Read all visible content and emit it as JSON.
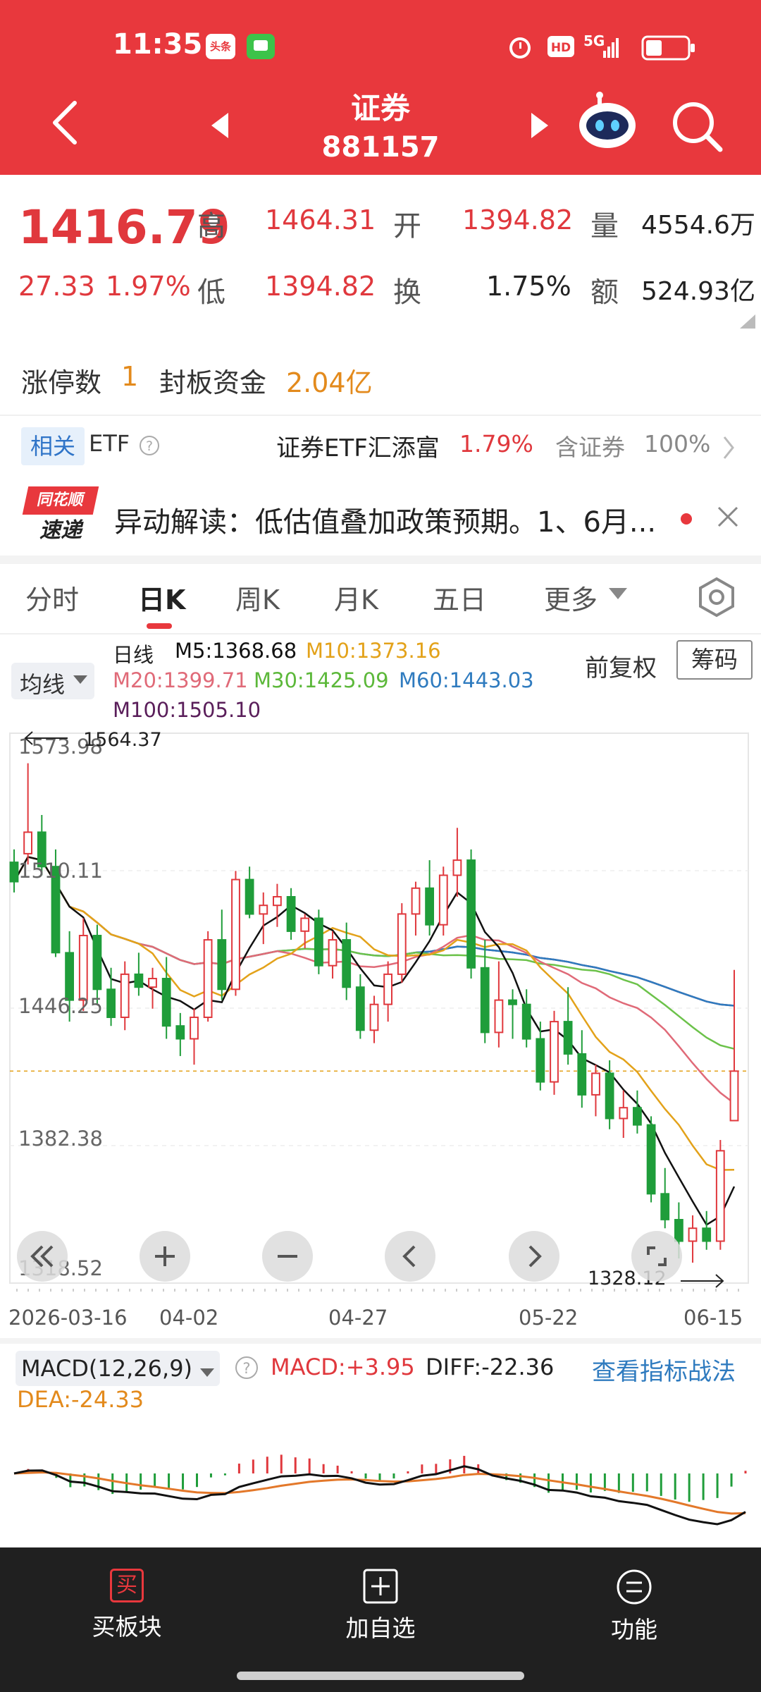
{
  "status_bar": {
    "time": "11:35",
    "app_badge": "头条",
    "network": "5G"
  },
  "header": {
    "title": "证券",
    "code": "881157"
  },
  "quote": {
    "price": "1416.79",
    "change": "27.33",
    "change_pct": "1.97%",
    "high_label": "高",
    "high": "1464.31",
    "low_label": "低",
    "low": "1394.82",
    "open_label": "开",
    "open": "1394.82",
    "turnover_label": "换",
    "turnover": "1.75%",
    "volume_label": "量",
    "volume": "4554.6万",
    "amount_label": "额",
    "amount": "524.93亿"
  },
  "limit_info": {
    "limit_up_label": "涨停数",
    "limit_up_count": "1",
    "seal_label": "封板资金",
    "seal_value": "2.04亿"
  },
  "etf": {
    "tag": "相关",
    "label": "ETF",
    "name": "证券ETF汇添富",
    "pct": "1.79%",
    "contain_label": "含证券",
    "contain_pct": "100%"
  },
  "news": {
    "logo_top": "同花顺",
    "logo_bottom": "速递",
    "text": "异动解读：低估值叠加政策预期。1、6月..."
  },
  "tabs": [
    "分时",
    "日K",
    "周K",
    "月K",
    "五日",
    "更多"
  ],
  "active_tab": "日K",
  "ma_panel": {
    "selector": "均线",
    "line_label": "日线",
    "m5": "M5:1368.68",
    "m10": "M10:1373.16",
    "m20": "M20:1399.71",
    "m30": "M30:1425.09",
    "m60": "M60:1443.03",
    "m100": "M100:1505.10",
    "adjust": "前复权",
    "chips": "筹码"
  },
  "colors": {
    "red": "#e0383d",
    "green": "#1f9d3a",
    "m5": "#111111",
    "m10": "#e3a21a",
    "m20": "#e06a78",
    "m30": "#6cc24a",
    "m60": "#2f7bbf",
    "m100": "#5a1e5a"
  },
  "kchart": {
    "y_ticks": [
      "1573.98",
      "1510.11",
      "1446.25",
      "1382.38",
      "1318.52"
    ],
    "x_ticks": [
      "2026-03-16",
      "04-02",
      "04-27",
      "05-22",
      "06-15"
    ],
    "max_label": "1564.37",
    "min_label": "1328.12"
  },
  "chart_data": {
    "type": "candlestick",
    "ylim": [
      1318.52,
      1573.98
    ],
    "candles": [
      [
        1514,
        1520,
        1500,
        1505
      ],
      [
        1518,
        1560,
        1513,
        1528
      ],
      [
        1528,
        1536,
        1508,
        1512
      ],
      [
        1512,
        1520,
        1470,
        1472
      ],
      [
        1472,
        1482,
        1440,
        1450
      ],
      [
        1450,
        1488,
        1445,
        1480
      ],
      [
        1480,
        1485,
        1448,
        1455
      ],
      [
        1455,
        1465,
        1438,
        1442
      ],
      [
        1442,
        1468,
        1436,
        1462
      ],
      [
        1462,
        1472,
        1452,
        1456
      ],
      [
        1456,
        1465,
        1446,
        1460
      ],
      [
        1460,
        1470,
        1432,
        1438
      ],
      [
        1438,
        1444,
        1424,
        1432
      ],
      [
        1432,
        1446,
        1420,
        1442
      ],
      [
        1442,
        1482,
        1440,
        1478
      ],
      [
        1478,
        1492,
        1450,
        1455
      ],
      [
        1455,
        1510,
        1452,
        1506
      ],
      [
        1506,
        1512,
        1488,
        1490
      ],
      [
        1490,
        1500,
        1476,
        1494
      ],
      [
        1494,
        1504,
        1484,
        1498
      ],
      [
        1498,
        1502,
        1478,
        1482
      ],
      [
        1482,
        1490,
        1474,
        1488
      ],
      [
        1488,
        1492,
        1462,
        1466
      ],
      [
        1466,
        1482,
        1460,
        1478
      ],
      [
        1478,
        1486,
        1450,
        1456
      ],
      [
        1456,
        1462,
        1432,
        1436
      ],
      [
        1436,
        1452,
        1430,
        1448
      ],
      [
        1448,
        1468,
        1440,
        1462
      ],
      [
        1462,
        1495,
        1458,
        1490
      ],
      [
        1490,
        1505,
        1480,
        1502
      ],
      [
        1502,
        1515,
        1480,
        1485
      ],
      [
        1485,
        1512,
        1480,
        1508
      ],
      [
        1508,
        1530,
        1498,
        1515
      ],
      [
        1515,
        1520,
        1460,
        1465
      ],
      [
        1465,
        1478,
        1430,
        1435
      ],
      [
        1435,
        1468,
        1428,
        1450
      ],
      [
        1450,
        1455,
        1432,
        1448
      ],
      [
        1448,
        1455,
        1428,
        1432
      ],
      [
        1432,
        1440,
        1408,
        1412
      ],
      [
        1412,
        1445,
        1406,
        1440
      ],
      [
        1440,
        1456,
        1420,
        1425
      ],
      [
        1425,
        1436,
        1400,
        1406
      ],
      [
        1406,
        1420,
        1396,
        1416
      ],
      [
        1416,
        1422,
        1390,
        1395
      ],
      [
        1395,
        1408,
        1386,
        1400
      ],
      [
        1400,
        1408,
        1388,
        1392
      ],
      [
        1392,
        1396,
        1356,
        1360
      ],
      [
        1360,
        1372,
        1344,
        1348
      ],
      [
        1348,
        1356,
        1330,
        1338
      ],
      [
        1338,
        1350,
        1328,
        1344
      ],
      [
        1344,
        1352,
        1334,
        1338
      ],
      [
        1338,
        1385,
        1334,
        1380
      ],
      [
        1394,
        1464,
        1394,
        1417
      ]
    ],
    "ma_series": [
      "M5",
      "M10",
      "M20",
      "M30",
      "M60",
      "M100"
    ]
  },
  "macd": {
    "selector": "MACD(12,26,9)",
    "macd_val": "MACD:+3.95",
    "diff_val": "DIFF:-22.36",
    "dea_val": "DEA:-24.33",
    "strategy_link": "查看指标战法"
  },
  "bottom_bar": {
    "buy": "买板块",
    "add": "加自选",
    "func": "功能",
    "buy_icon": "买"
  }
}
